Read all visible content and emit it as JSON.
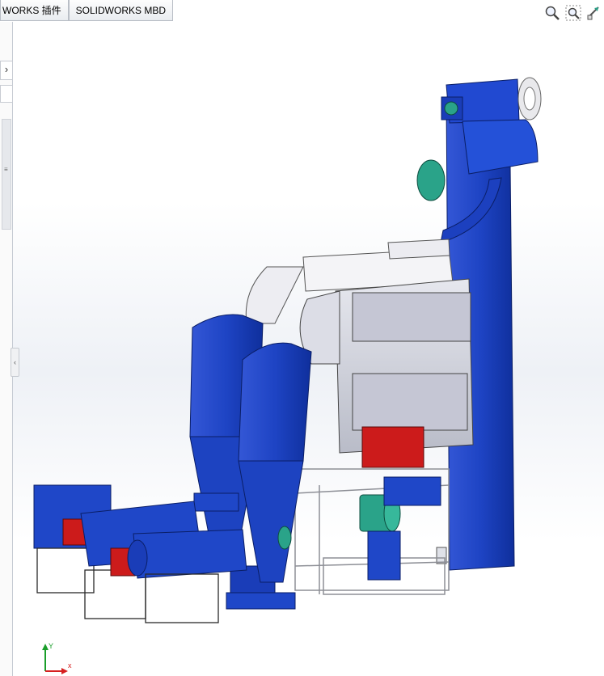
{
  "tabs": [
    {
      "label": "WORKS 插件"
    },
    {
      "label": "SOLIDWORKS MBD"
    }
  ],
  "side_panel": {
    "collapse_glyph": "›",
    "handle_glyph": "‹"
  },
  "view_toolbar": {
    "icons": [
      "zoom-to-fit-icon",
      "zoom-to-area-icon",
      "previous-view-icon"
    ]
  },
  "colors": {
    "part_blue": "#1f47c8",
    "part_blue_dark": "#0d2b8f",
    "motor_teal": "#2aa389",
    "motor_red": "#cc1b1b",
    "sheet_gray": "#cfd2dc",
    "frame_gray": "#8d8f96"
  },
  "triad": {
    "x_label": "x",
    "y_label": "Y"
  }
}
